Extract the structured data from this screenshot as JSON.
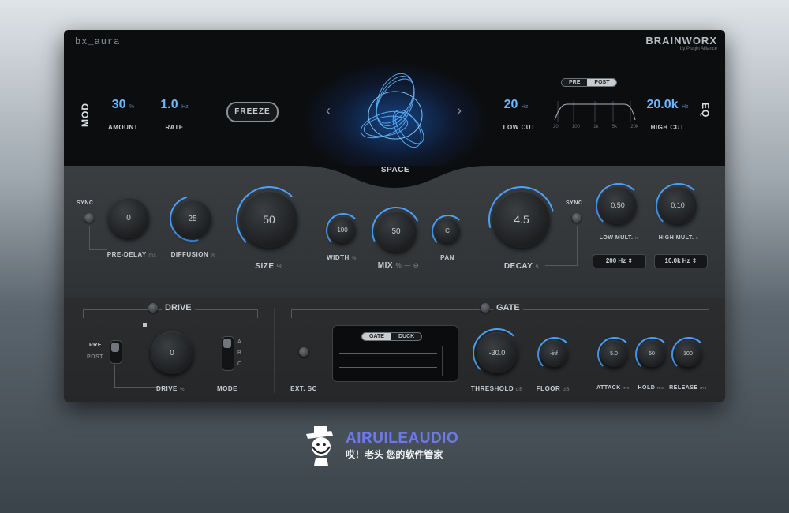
{
  "plugin": {
    "title": "bx_aura",
    "brand": "BRAINWORX",
    "brand_sub": "by Plugin Alliance"
  },
  "mod": {
    "label": "MOD",
    "amount": {
      "value": "30",
      "unit": "%",
      "label": "AMOUNT"
    },
    "rate": {
      "value": "1.0",
      "unit": "Hz",
      "label": "RATE"
    }
  },
  "freeze_label": "FREEZE",
  "space": {
    "label": "SPACE",
    "prev": "‹",
    "next": "›"
  },
  "eq": {
    "label": "EQ",
    "low_cut": {
      "value": "20",
      "unit": "Hz",
      "label": "LOW CUT"
    },
    "high_cut": {
      "value": "20.0k",
      "unit": "Hz",
      "label": "HIGH CUT"
    },
    "toggle": [
      "PRE",
      "POST"
    ],
    "toggle_active": "POST",
    "freq_ticks": [
      "20",
      "100",
      "1k",
      "5k",
      "20k"
    ]
  },
  "reverb": {
    "sync_left": "SYNC",
    "pre_delay": {
      "value": "0",
      "label": "PRE-DELAY",
      "unit": "ms"
    },
    "diffusion": {
      "value": "25",
      "label": "DIFFUSION",
      "unit": "%"
    },
    "size": {
      "value": "50",
      "label": "SIZE",
      "unit": "%"
    },
    "width": {
      "value": "100",
      "label": "WIDTH",
      "unit": "%"
    },
    "mix": {
      "value": "50",
      "label": "MIX",
      "unit": "% —  ⊖"
    },
    "pan": {
      "value": "C",
      "label": "PAN"
    },
    "decay": {
      "value": "4.5",
      "label": "DECAY",
      "unit": "s"
    },
    "sync_right": "SYNC",
    "low_mult": {
      "value": "0.50",
      "label": "LOW MULT.",
      "unit": "x",
      "freq": "200 Hz ⇕"
    },
    "high_mult": {
      "value": "0.10",
      "label": "HIGH MULT.",
      "unit": "x",
      "freq": "10.0k Hz ⇕"
    }
  },
  "drive": {
    "label": "DRIVE",
    "pre": "PRE",
    "post": "POST",
    "value": "0",
    "knob_label": "DRIVE",
    "unit": "%",
    "mode_label": "MODE",
    "modes": [
      "A",
      "B",
      "C"
    ]
  },
  "gate": {
    "label": "GATE",
    "ext_sc": "EXT. SC",
    "toggle": [
      "GATE",
      "DUCK"
    ],
    "toggle_active": "GATE",
    "threshold": {
      "value": "-30.0",
      "label": "THRESHOLD",
      "unit": "dB"
    },
    "floor": {
      "value": "-inf",
      "label": "FLOOR",
      "unit": "dB"
    },
    "attack": {
      "value": "5.0",
      "label": "ATTACK",
      "unit": "ms"
    },
    "hold": {
      "value": "50",
      "label": "HOLD",
      "unit": "ms"
    },
    "release": {
      "value": "100",
      "label": "RELEASE",
      "unit": "ms"
    }
  },
  "watermark": {
    "name": "AIRUILEAUDIO",
    "tagline": "哎！老头 您的软件管家"
  },
  "colors": {
    "accent": "#4aa2ff",
    "value_text": "#6fb6ff",
    "watermark": "#6f78e8"
  }
}
